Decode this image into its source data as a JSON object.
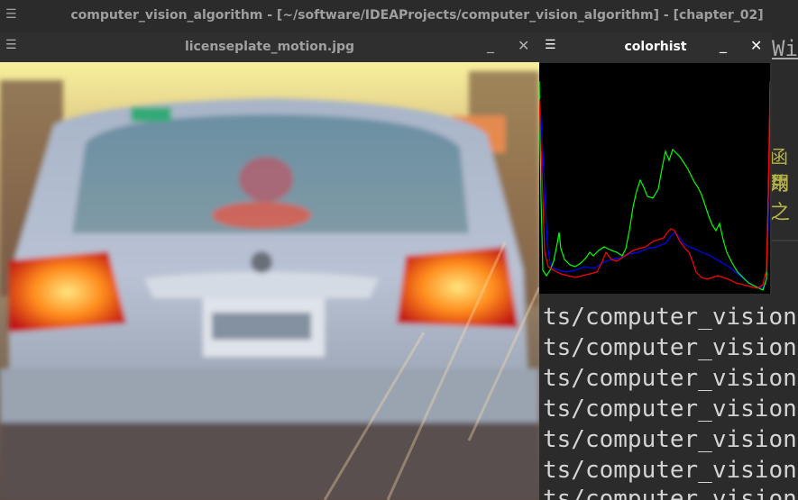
{
  "main_window": {
    "menu_icon": "hamburger-icon",
    "title": "computer_vision_algorithm - [~/software/IDEAProjects/computer_vision_algorithm] - [chapter_02]"
  },
  "ide_background": {
    "tab_fragment": "Wir",
    "cjk_line1": "函数",
    "cjk_line2": "用之",
    "terminal_lines": [
      "ts/computer_vision",
      "ts/computer_vision",
      "ts/computer_vision",
      "ts/computer_vision",
      "ts/computer_vision",
      "ts/computer_vision",
      "ts/computer_vision"
    ]
  },
  "image_window": {
    "title": "licenseplate_motion.jpg",
    "menu_icon": "hamburger-icon",
    "minimize_label": "_",
    "close_label": "✕"
  },
  "histogram_window": {
    "title": "colorhist",
    "menu_icon": "hamburger-icon",
    "minimize_label": "_",
    "close_label": "✕",
    "colors": {
      "blue": "#0000ff",
      "green": "#00ff00",
      "red": "#ff0000",
      "background": "#000000"
    }
  }
}
